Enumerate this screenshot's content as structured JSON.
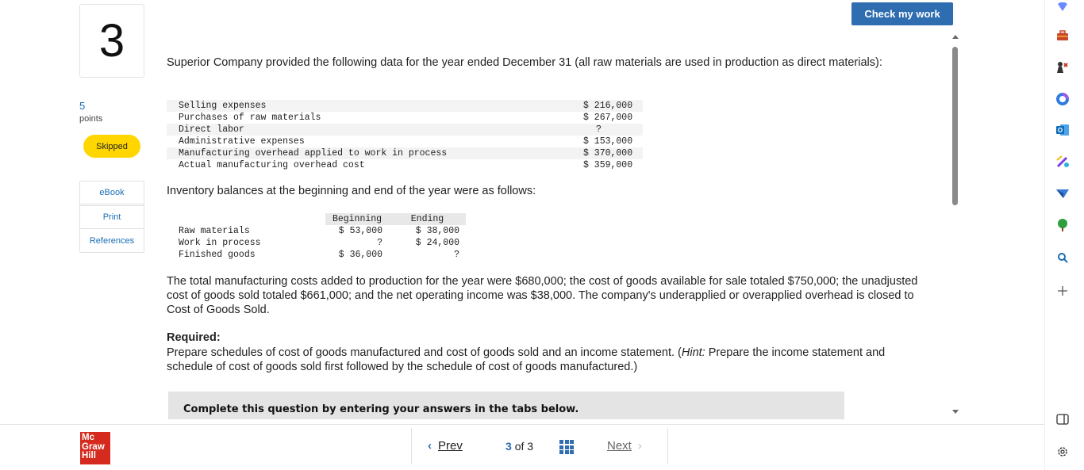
{
  "question": {
    "number": "3",
    "points_value": "5",
    "points_label": "points",
    "status_badge": "Skipped",
    "side_links": [
      "eBook",
      "Print",
      "References"
    ],
    "check_button": "Check my work",
    "intro": "Superior Company provided the following data for the year ended December 31 (all raw materials are used in production as direct materials):",
    "data_rows": [
      {
        "label": "Selling expenses",
        "value": "$ 216,000"
      },
      {
        "label": "Purchases of raw materials",
        "value": "$ 267,000"
      },
      {
        "label": "Direct labor",
        "value": "?"
      },
      {
        "label": "Administrative expenses",
        "value": "$ 153,000"
      },
      {
        "label": "Manufacturing overhead applied to work in process",
        "value": "$ 370,000"
      },
      {
        "label": "Actual manufacturing overhead cost",
        "value": "$ 359,000"
      }
    ],
    "inventory_intro": "Inventory balances at the beginning and end of the year were as follows:",
    "inventory_headers": {
      "beginning": "Beginning",
      "ending": "Ending"
    },
    "inventory_rows": [
      {
        "label": "Raw materials",
        "beginning": "$ 53,000",
        "ending": "$ 38,000"
      },
      {
        "label": "Work in process",
        "beginning": "?",
        "ending": "$ 24,000"
      },
      {
        "label": "Finished goods",
        "beginning": "$ 36,000",
        "ending": "?"
      }
    ],
    "details": "The total manufacturing costs added to production for the year were $680,000; the cost of goods available for sale totaled $750,000; the unadjusted cost of goods sold totaled $661,000; and the net operating income was $38,000. The company's underapplied or overapplied overhead is closed to Cost of Goods Sold.",
    "required_title": "Required:",
    "required_text_1": "Prepare schedules of cost of goods manufactured and cost of goods sold and an income statement. (",
    "required_hint": "Hint:",
    "required_text_2": " Prepare the income statement and schedule of cost of goods sold first followed by the schedule of cost of goods manufactured.)",
    "complete_bar": "Complete this question by entering your answers in the tabs below."
  },
  "footer": {
    "logo_lines": [
      "Mc",
      "Graw",
      "Hill"
    ],
    "prev": "Prev",
    "current": "3",
    "of_text": "of 3",
    "next": "Next"
  },
  "sidebar_icons": [
    "diamond-icon",
    "briefcase-icon",
    "chess-icon",
    "copilot-icon",
    "outlook-icon",
    "designer-icon",
    "send-icon",
    "tree-icon",
    "search-icon",
    "plus-icon",
    "split-view-icon",
    "settings-icon"
  ],
  "colors": {
    "accent": "#2e6db0",
    "badge": "#ffd600",
    "logo": "#d52b1e"
  }
}
